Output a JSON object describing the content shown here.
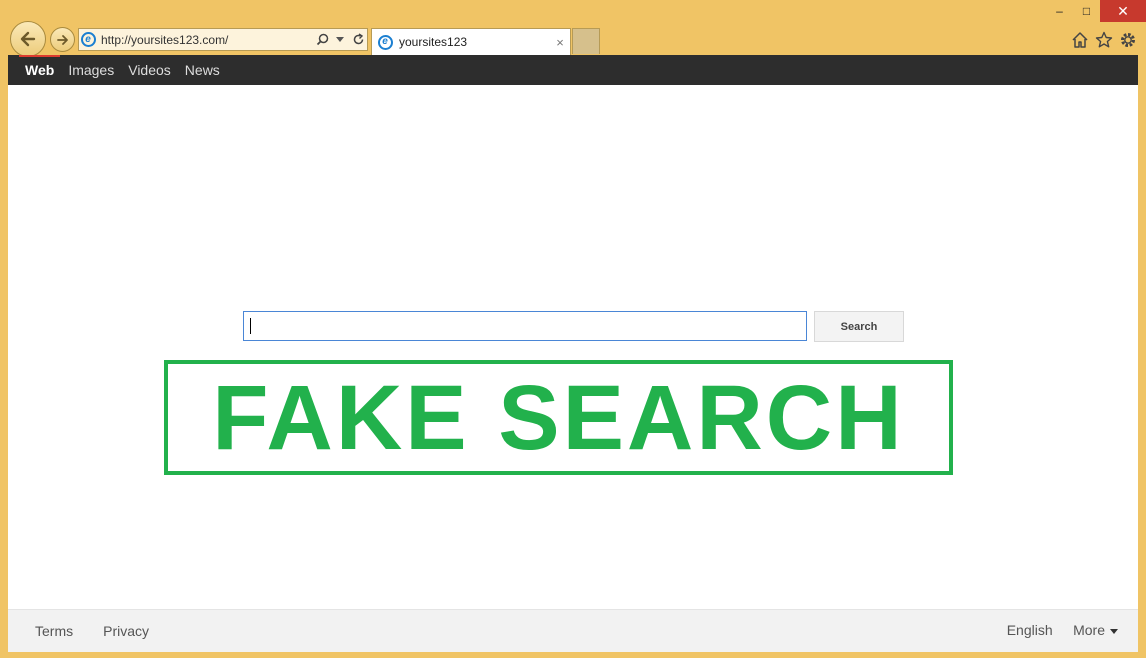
{
  "browser": {
    "url": "http://yoursites123.com/",
    "tab_title": "yoursites123",
    "tab_close": "×",
    "icons": [
      "back-arrow-icon",
      "forward-arrow-icon",
      "ie-icon",
      "search-icon",
      "dropdown-icon",
      "refresh-icon",
      "home-icon",
      "star-icon",
      "gear-icon"
    ],
    "window_controls": {
      "minimize": "–",
      "maximize": "□",
      "close": "✕"
    }
  },
  "topnav": {
    "items": [
      {
        "label": "Web",
        "active": true
      },
      {
        "label": "Images"
      },
      {
        "label": "Videos"
      },
      {
        "label": "News"
      }
    ]
  },
  "search": {
    "value": "",
    "button_label": "Search"
  },
  "overlay": {
    "stamp_text": "FAKE SEARCH",
    "color": "#22b14c"
  },
  "footer": {
    "left_links": [
      "Terms",
      "Privacy"
    ],
    "language": "English",
    "more_label": "More"
  },
  "colors": {
    "window_frame": "#f0c465",
    "nav_bar": "#2d2d2d",
    "active_nav_underline": "#dd3b2f",
    "search_border": "#4a86d6"
  }
}
